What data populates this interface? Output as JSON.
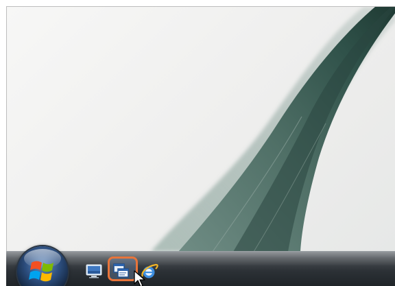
{
  "desktop": {
    "wallpaper": "green-leaf-wallpaper"
  },
  "taskbar": {
    "start_button": {
      "icon": "windows-logo-icon"
    },
    "quick_launch": [
      {
        "name": "show-desktop",
        "icon": "show-desktop-icon"
      },
      {
        "name": "switch-between-windows",
        "icon": "switch-windows-icon",
        "highlighted": true
      },
      {
        "name": "internet-explorer",
        "icon": "internet-explorer-icon"
      }
    ]
  },
  "colors": {
    "highlight_border": "#e8743a",
    "taskbar_dark": "#1f2428",
    "leaf_green": "#4f6f66"
  }
}
